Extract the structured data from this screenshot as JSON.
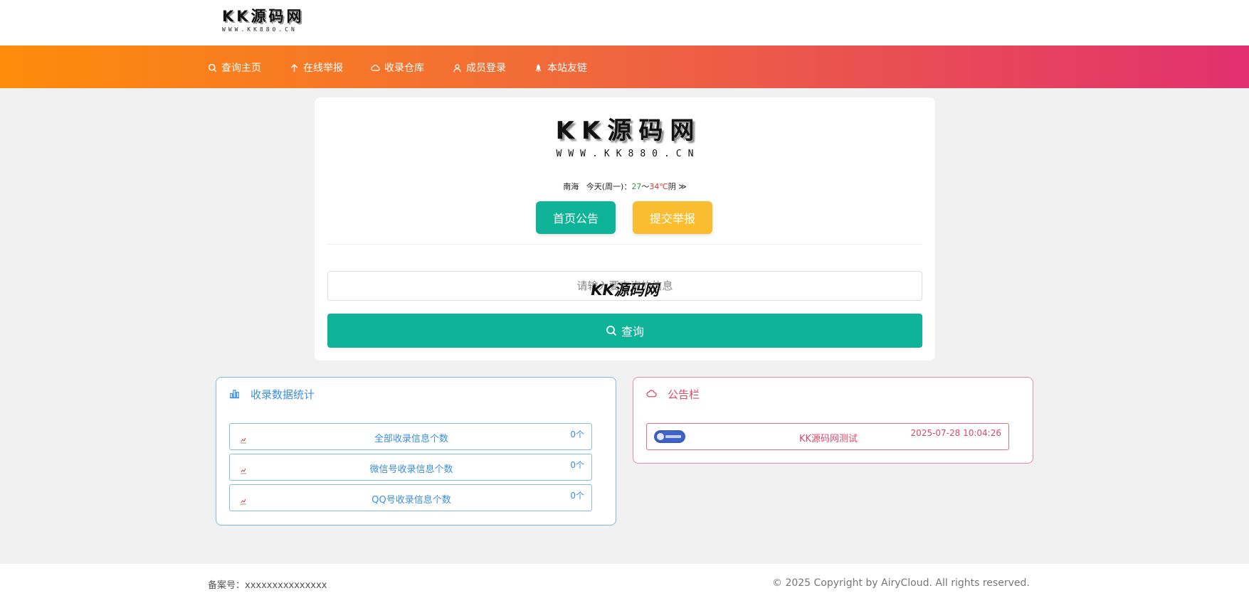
{
  "header": {
    "logo_title": "KK源码网",
    "logo_url": "WWW.KK880.CN"
  },
  "nav": {
    "items": [
      {
        "label": "查询主页",
        "icon": "search-icon"
      },
      {
        "label": "在线举报",
        "icon": "arrow-up-icon"
      },
      {
        "label": "收录仓库",
        "icon": "cloud-icon"
      },
      {
        "label": "成员登录",
        "icon": "user-icon"
      },
      {
        "label": "本站友链",
        "icon": "rocket-icon"
      }
    ]
  },
  "main": {
    "logo_title": "KK源码网",
    "logo_url": "WWW.KK880.CN",
    "weather": {
      "city": "南海",
      "day": "今天(周一)：",
      "low": "27",
      "sep": "～",
      "high": "34℃",
      "condition": "阴",
      "more": "≫"
    },
    "notice_button": "首页公告",
    "report_button": "提交举报",
    "search": {
      "placeholder": "请输入要查询的信息",
      "watermark": "KK源码网",
      "button": "查询"
    }
  },
  "stats_panel": {
    "title": "收录数据统计",
    "rows": [
      {
        "label": "全部收录信息个数",
        "count": "0个"
      },
      {
        "label": "微信号收录信息个数",
        "count": "0个"
      },
      {
        "label": "QQ号收录信息个数",
        "count": "0个"
      }
    ]
  },
  "notice_panel": {
    "title": "公告栏",
    "items": [
      {
        "text": "KK源码网测试",
        "time": "2025-07-28 10:04:26"
      }
    ]
  },
  "footer": {
    "icp": "备案号：xxxxxxxxxxxxxxx",
    "copyright": "© 2025 Copyright by AiryCloud. All rights reserved."
  },
  "colors": {
    "teal": "#0fb398",
    "amber": "#fbbd30",
    "nav_start": "#ff8c0a",
    "nav_end": "#e2306f",
    "stats_blue": "#3a8ee6",
    "notice_red": "#e04764"
  }
}
